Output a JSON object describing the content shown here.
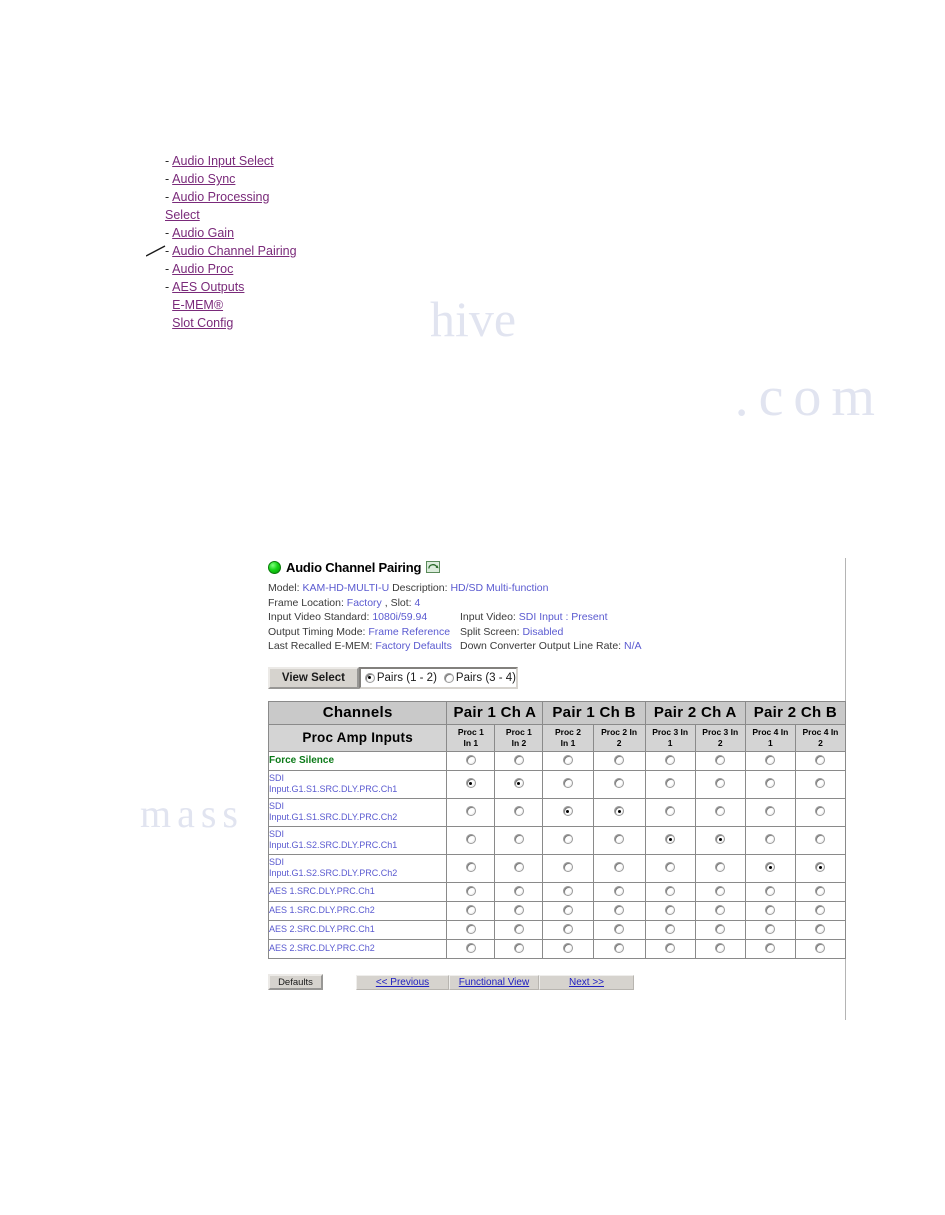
{
  "nav": {
    "items": [
      {
        "dash": "-",
        "label": "Audio Input Select",
        "continuation": null
      },
      {
        "dash": "-",
        "label": "Audio Sync",
        "continuation": null
      },
      {
        "dash": "-",
        "label": "Audio Processing",
        "continuation": "Select"
      },
      {
        "dash": "-",
        "label": "Audio Gain",
        "continuation": null
      },
      {
        "dash": "-",
        "label": "Audio Channel Pairing",
        "continuation": null
      },
      {
        "dash": "-",
        "label": "Audio Proc",
        "continuation": null
      },
      {
        "dash": "-",
        "label": "AES Outputs",
        "continuation": null
      },
      {
        "dash": "",
        "label": "E-MEM®",
        "continuation": null
      },
      {
        "dash": "",
        "label": "Slot Config",
        "continuation": null
      }
    ]
  },
  "panel": {
    "title": "Audio Channel Pairing",
    "status_led_color": "#17d417",
    "refresh_icon": "refresh-icon",
    "info": {
      "line1": [
        {
          "label": "Model:",
          "value": "KAM-HD-MULTI-U"
        },
        {
          "label": "Description:",
          "value": "HD/SD Multi-function"
        }
      ],
      "line2": [
        {
          "label": "Frame Location:",
          "value": "Factory"
        },
        {
          "label": ", Slot:",
          "value": "4"
        }
      ],
      "rows": [
        {
          "left_label": "Input Video Standard:",
          "left_value": "1080i/59.94",
          "right_label": "Input Video:",
          "right_value": "SDI Input : Present"
        },
        {
          "left_label": "Output Timing Mode:",
          "left_value": "Frame Reference",
          "right_label": "Split Screen:",
          "right_value": "Disabled"
        },
        {
          "left_label": "Last Recalled E-MEM:",
          "left_value": "Factory Defaults",
          "right_label": "Down Converter Output Line Rate:",
          "right_value": "N/A"
        }
      ]
    },
    "view_select": {
      "label": "View Select",
      "options": [
        {
          "label": "Pairs (1 - 2)",
          "checked": true
        },
        {
          "label": "Pairs (3 - 4)",
          "checked": false
        }
      ]
    },
    "table": {
      "corner_header": "Channels",
      "corner_subheader": "Proc Amp Inputs",
      "pair_headers": [
        "Pair 1 Ch A",
        "Pair 1 Ch B",
        "Pair 2 Ch A",
        "Pair 2 Ch B"
      ],
      "column_subheaders": [
        {
          "l1": "Proc 1",
          "l2": "In 1"
        },
        {
          "l1": "Proc 1",
          "l2": "In 2"
        },
        {
          "l1": "Proc 2",
          "l2": "In 1"
        },
        {
          "l1": "Proc 2 In",
          "l2": "2"
        },
        {
          "l1": "Proc 3 In",
          "l2": "1"
        },
        {
          "l1": "Proc 3 In",
          "l2": "2"
        },
        {
          "l1": "Proc 4 In",
          "l2": "1"
        },
        {
          "l1": "Proc 4 In",
          "l2": "2"
        }
      ],
      "rows": [
        {
          "kind": "force",
          "l1": "Force Silence",
          "l2": "",
          "tall": false,
          "selected": [
            false,
            false,
            false,
            false,
            false,
            false,
            false,
            false
          ]
        },
        {
          "kind": "sdi",
          "l1": "SDI",
          "l2": "Input.G1.S1.SRC.DLY.PRC.Ch1",
          "tall": true,
          "selected": [
            true,
            true,
            false,
            false,
            false,
            false,
            false,
            false
          ]
        },
        {
          "kind": "sdi",
          "l1": "SDI",
          "l2": "Input.G1.S1.SRC.DLY.PRC.Ch2",
          "tall": true,
          "selected": [
            false,
            false,
            true,
            true,
            false,
            false,
            false,
            false
          ]
        },
        {
          "kind": "sdi",
          "l1": "SDI",
          "l2": "Input.G1.S2.SRC.DLY.PRC.Ch1",
          "tall": true,
          "selected": [
            false,
            false,
            false,
            false,
            true,
            true,
            false,
            false
          ]
        },
        {
          "kind": "sdi",
          "l1": "SDI",
          "l2": "Input.G1.S2.SRC.DLY.PRC.Ch2",
          "tall": true,
          "selected": [
            false,
            false,
            false,
            false,
            false,
            false,
            true,
            true
          ]
        },
        {
          "kind": "aes",
          "l1": "AES 1.SRC.DLY.PRC.Ch1",
          "l2": "",
          "tall": false,
          "selected": [
            false,
            false,
            false,
            false,
            false,
            false,
            false,
            false
          ]
        },
        {
          "kind": "aes",
          "l1": "AES 1.SRC.DLY.PRC.Ch2",
          "l2": "",
          "tall": false,
          "selected": [
            false,
            false,
            false,
            false,
            false,
            false,
            false,
            false
          ]
        },
        {
          "kind": "aes",
          "l1": "AES 2.SRC.DLY.PRC.Ch1",
          "l2": "",
          "tall": false,
          "selected": [
            false,
            false,
            false,
            false,
            false,
            false,
            false,
            false
          ]
        },
        {
          "kind": "aes",
          "l1": "AES 2.SRC.DLY.PRC.Ch2",
          "l2": "",
          "tall": false,
          "selected": [
            false,
            false,
            false,
            false,
            false,
            false,
            false,
            false
          ]
        }
      ]
    },
    "buttons": {
      "defaults": "Defaults",
      "previous": "<< Previous",
      "functional_view": "Functional View",
      "next": "Next >>"
    }
  },
  "watermark": {
    "dotcom": ".com",
    "left": "mass",
    "arc": "hive"
  },
  "colors": {
    "link": "#7a2a7a",
    "value": "#5a5ad0",
    "force_silence": "#0b7a18",
    "button_link": "#2020c0",
    "header_bg": "#c9c9c9"
  }
}
